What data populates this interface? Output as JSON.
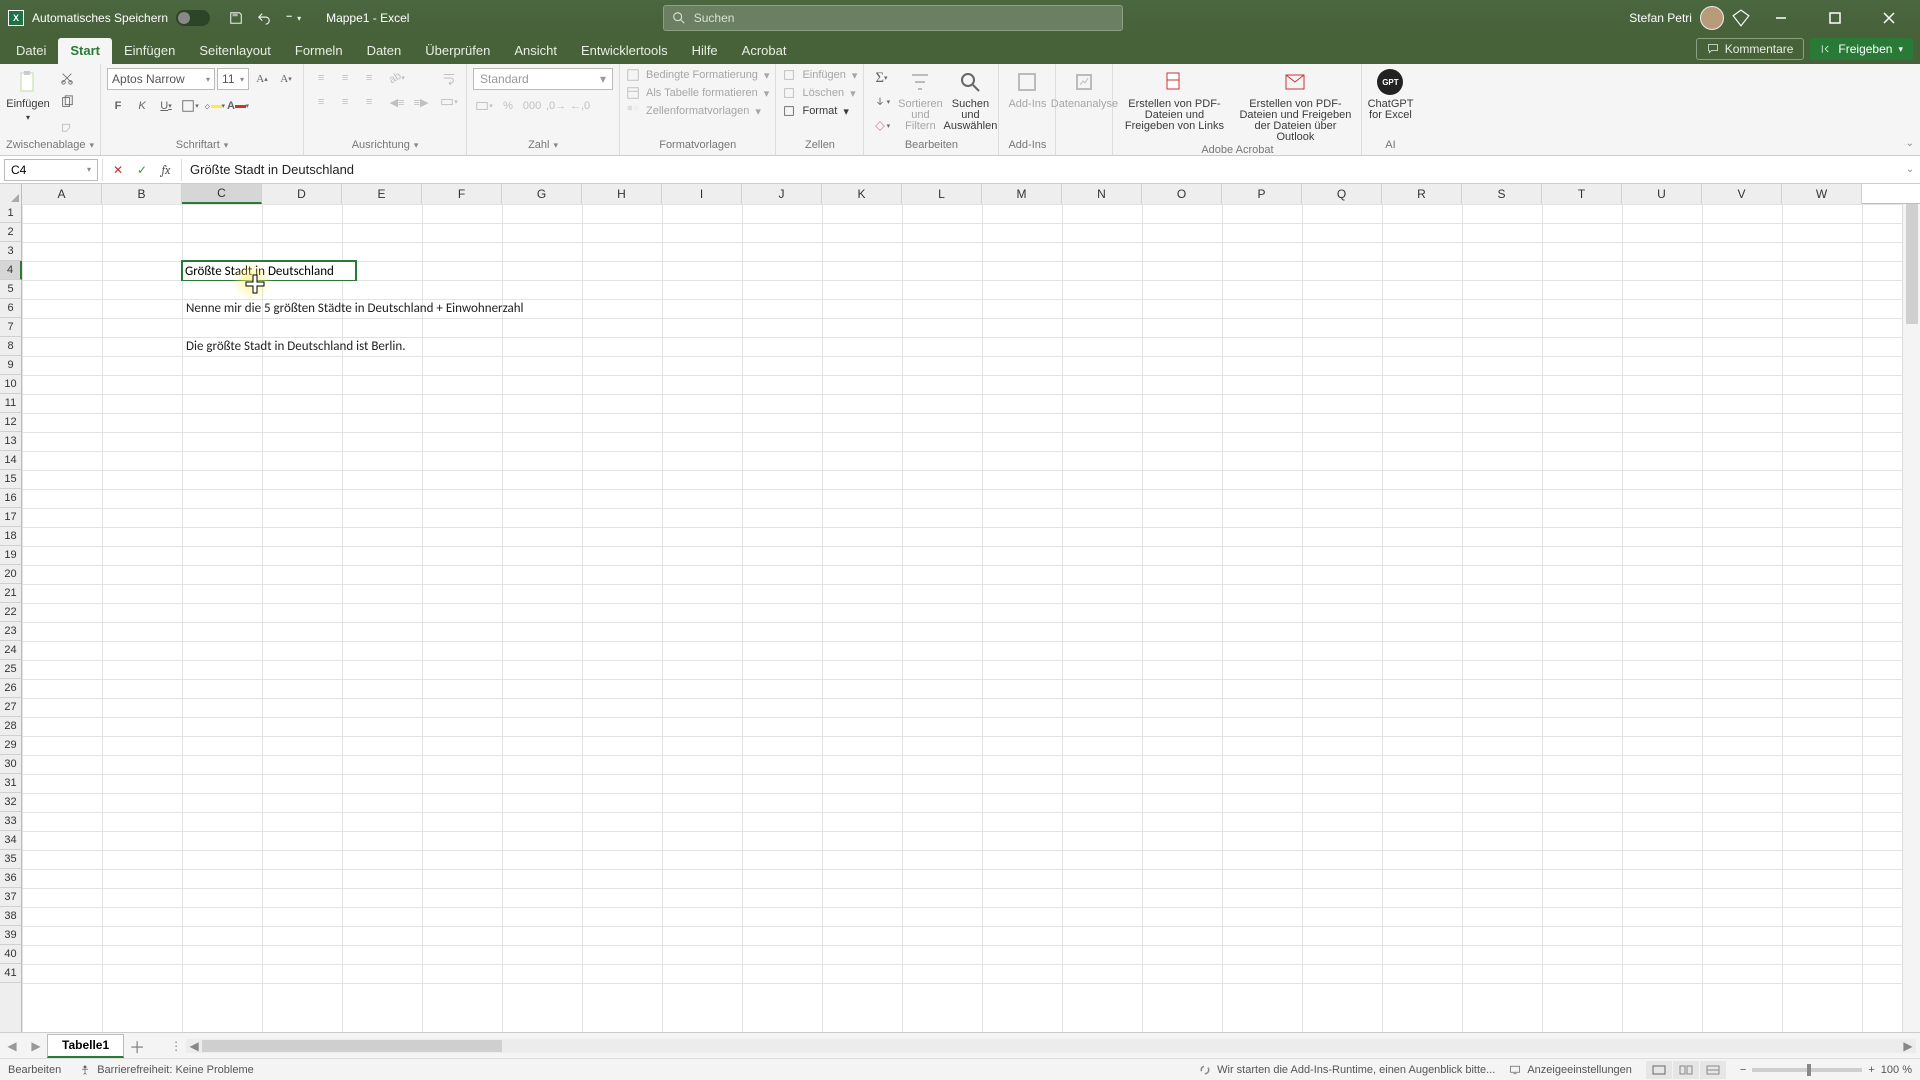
{
  "titlebar": {
    "autosave_label": "Automatisches Speichern",
    "doc_name": "Mappe1",
    "app_name": "Excel",
    "search_placeholder": "Suchen",
    "user_name": "Stefan Petri"
  },
  "tabs": {
    "datei": "Datei",
    "start": "Start",
    "einfuegen": "Einfügen",
    "seitenlayout": "Seitenlayout",
    "formeln": "Formeln",
    "daten": "Daten",
    "ueberpruefen": "Überprüfen",
    "ansicht": "Ansicht",
    "entwicklertools": "Entwicklertools",
    "hilfe": "Hilfe",
    "acrobat": "Acrobat",
    "kommentare": "Kommentare",
    "freigeben": "Freigeben"
  },
  "ribbon": {
    "clipboard": {
      "paste": "Einfügen",
      "label": "Zwischenablage"
    },
    "font": {
      "name": "Aptos Narrow",
      "size": "11",
      "bold": "F",
      "italic": "K",
      "underline": "U",
      "label": "Schriftart"
    },
    "alignment": {
      "label": "Ausrichtung"
    },
    "number": {
      "format": "Standard",
      "label": "Zahl"
    },
    "styles": {
      "cond": "Bedingte Formatierung",
      "table": "Als Tabelle formatieren",
      "cellstyles": "Zellenformatvorlagen",
      "label": "Formatvorlagen"
    },
    "cells": {
      "insert": "Einfügen",
      "delete": "Löschen",
      "format": "Format",
      "label": "Zellen"
    },
    "editing": {
      "sort": "Sortieren und Filtern",
      "find": "Suchen und Auswählen",
      "label": "Bearbeiten"
    },
    "addins": {
      "addins": "Add-Ins",
      "label": "Add-Ins"
    },
    "analysis": {
      "analyze": "Datenanalyse"
    },
    "acrobat": {
      "createshare": "Erstellen von PDF-Dateien und Freigeben von Links",
      "createoutlook": "Erstellen von PDF-Dateien und Freigeben der Dateien über Outlook",
      "label": "Adobe Acrobat"
    },
    "ai": {
      "chatgpt": "ChatGPT for Excel",
      "label": "AI"
    }
  },
  "formula": {
    "cell_ref": "C4",
    "content": "Größte Stadt in Deutschland"
  },
  "columns": [
    "A",
    "B",
    "C",
    "D",
    "E",
    "F",
    "G",
    "H",
    "I",
    "J",
    "K",
    "L",
    "M",
    "N",
    "O",
    "P",
    "Q",
    "R",
    "S",
    "T",
    "U",
    "V",
    "W"
  ],
  "rowcount": 41,
  "active_col_index": 2,
  "active_row": 4,
  "cell_c4": "Größte Stadt in Deutschland",
  "cell_c6": "Nenne mir die 5 größten Städte in Deutschland + Einwohnerzahl",
  "cell_c8": "Die größte Stadt in Deutschland ist Berlin.",
  "sheet_tab": "Tabelle1",
  "status": {
    "mode": "Bearbeiten",
    "accessibility": "Barrierefreiheit: Keine Probleme",
    "addin_loading": "Wir starten die Add-Ins-Runtime, einen Augenblick bitte...",
    "display_settings": "Anzeigeeinstellungen",
    "zoom": "100 %"
  }
}
